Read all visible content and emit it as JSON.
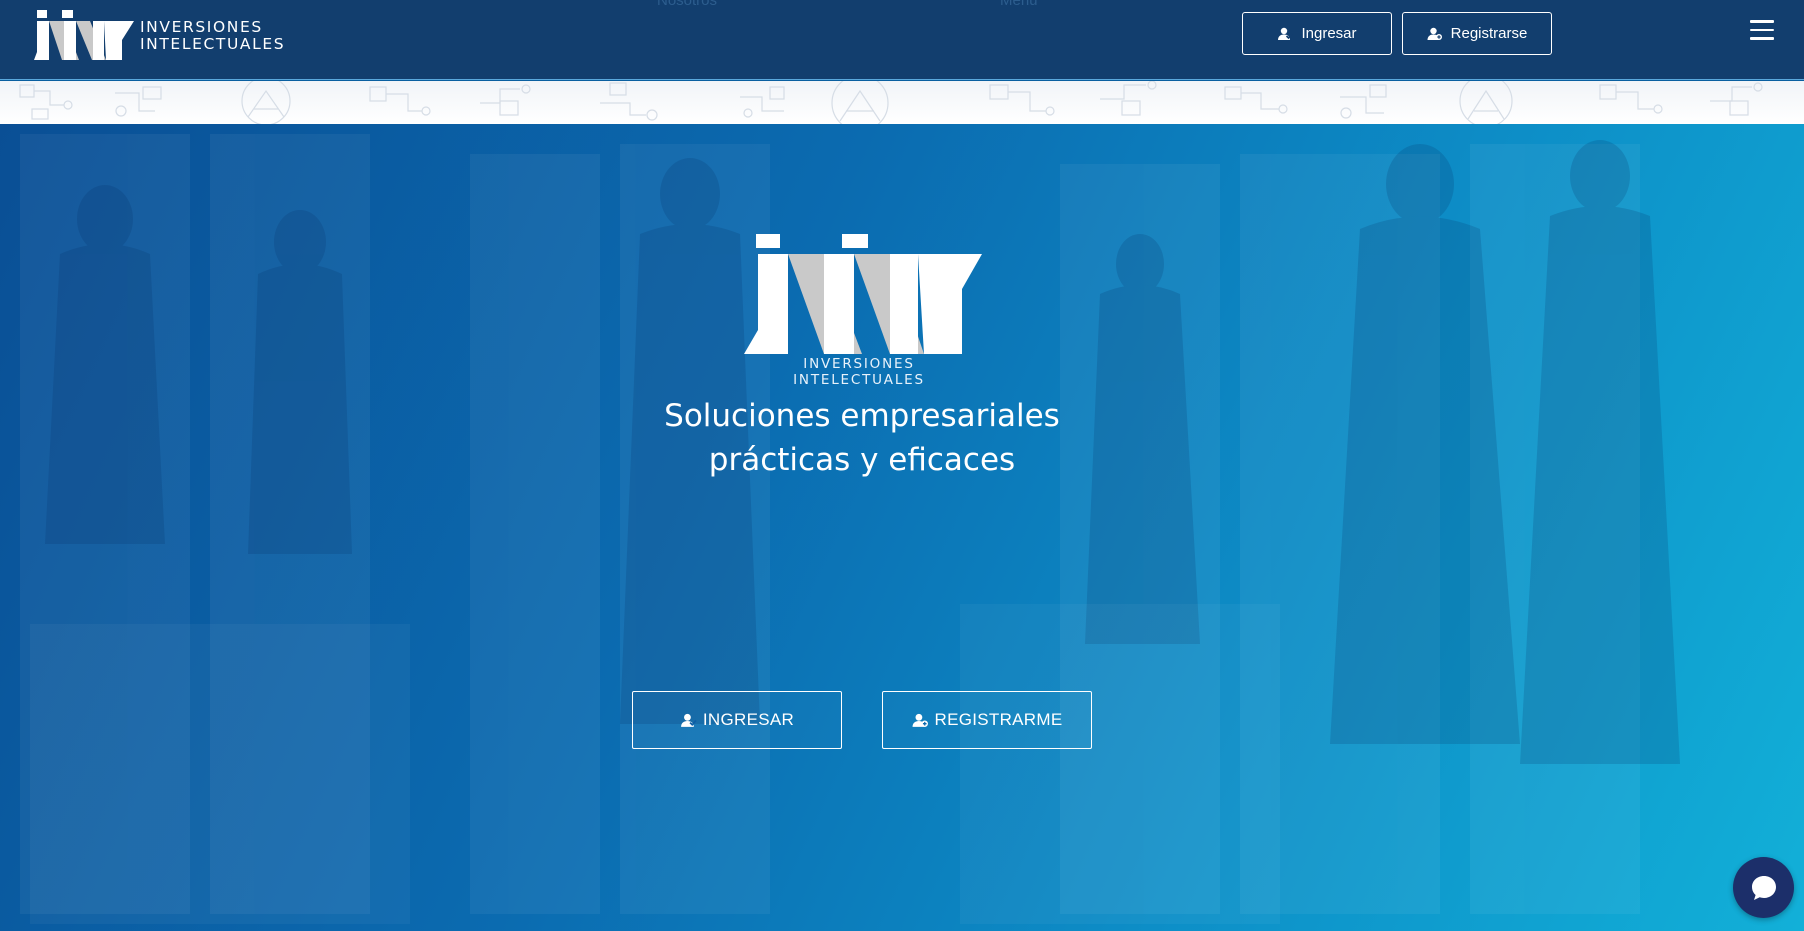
{
  "brand": {
    "name_line1": "INVERSIONES",
    "name_line2": "INTELECTUALES",
    "logo_icon": "iin-logo-icon"
  },
  "header": {
    "ghost_links": [
      "Nosotros",
      "Menú"
    ],
    "login_label": "Ingresar",
    "register_label": "Registrarse",
    "menu_icon": "hamburger-menu-icon"
  },
  "hero": {
    "logo_caption": "INVERSIONES INTELECTUALES",
    "tagline_line1": "Soluciones empresariales",
    "tagline_line2": "prácticas y eficaces",
    "cta_login": "INGRESAR",
    "cta_register": "REGISTRARME"
  },
  "chat": {
    "icon": "chat-bubble-icon"
  },
  "colors": {
    "header_bg": "#123e6e",
    "hero_gradient_start": "#0a4f95",
    "hero_gradient_end": "#12b0d8",
    "chat_bg": "#1c2f6a",
    "logo_gray": "#c9c9c9"
  }
}
